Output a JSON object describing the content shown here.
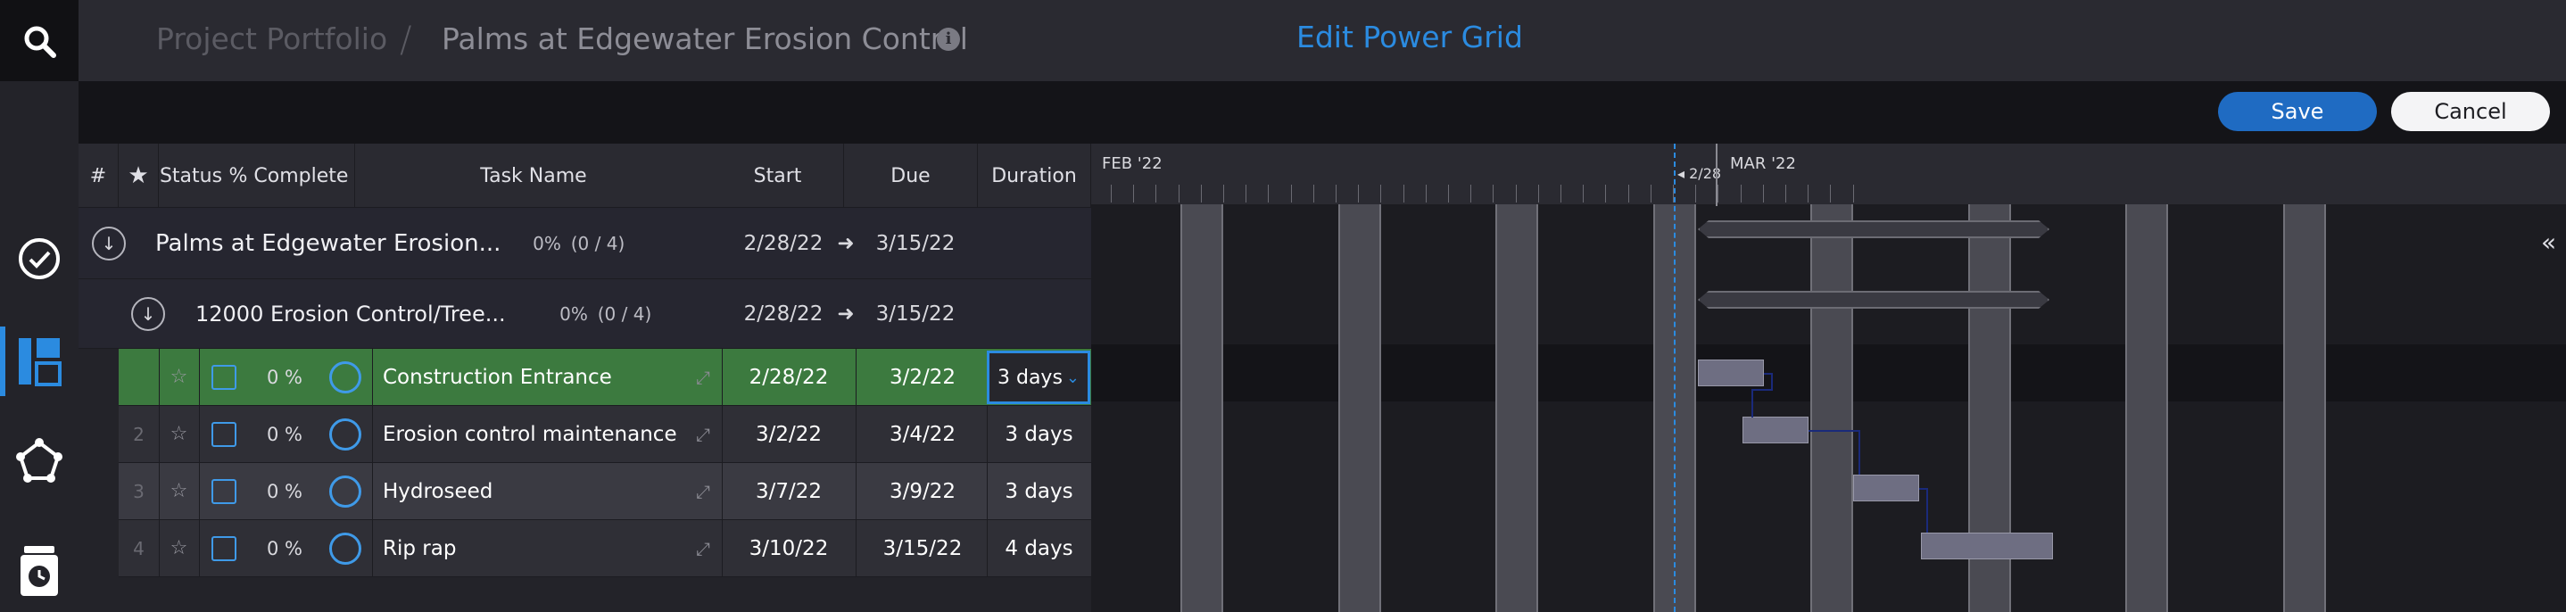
{
  "breadcrumb": {
    "root": "Project Portfolio",
    "separator": "/",
    "current": "Palms at Edgewater Erosion Control"
  },
  "page_title": "Edit Power Grid",
  "toolbar": {
    "save_label": "Save",
    "cancel_label": "Cancel"
  },
  "columns": [
    "#",
    "★",
    "Status",
    "% Complete",
    "Task Name",
    "Start",
    "Due",
    "Duration"
  ],
  "project_row": {
    "name": "Palms at Edgewater Erosion...",
    "percent": "0%",
    "count": "(0 / 4)",
    "start": "2/28/22",
    "arrow": "➜",
    "due": "3/15/22"
  },
  "sub_row": {
    "name": "12000 Erosion Control/Tree...",
    "percent": "0%",
    "count": "(0 / 4)",
    "start": "2/28/22",
    "arrow": "➜",
    "due": "3/15/22"
  },
  "tasks": [
    {
      "num": "",
      "pct": "0 %",
      "name": "Construction Entrance",
      "start": "2/28/22",
      "due": "3/2/22",
      "duration": "3 days"
    },
    {
      "num": "2",
      "pct": "0 %",
      "name": "Erosion control maintenance",
      "start": "3/2/22",
      "due": "3/4/22",
      "duration": "3 days"
    },
    {
      "num": "3",
      "pct": "0 %",
      "name": "Hydroseed",
      "start": "3/7/22",
      "due": "3/9/22",
      "duration": "3 days"
    },
    {
      "num": "4",
      "pct": "0 %",
      "name": "Rip rap",
      "start": "3/10/22",
      "due": "3/15/22",
      "duration": "4 days"
    }
  ],
  "gantt": {
    "month1": "FEB '22",
    "month2": "MAR '22",
    "today_label": "◂ 2/28"
  },
  "colors": {
    "accent": "#2b8be0",
    "selected_row": "#3c7a3f",
    "save_button": "#1f6bc2"
  }
}
